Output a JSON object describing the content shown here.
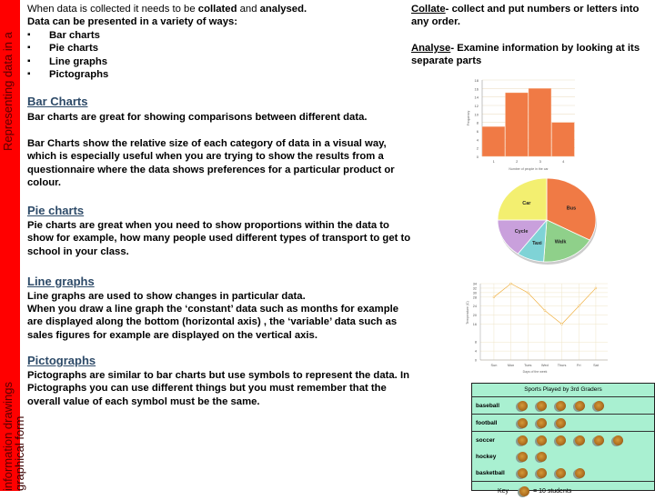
{
  "sidebar": {
    "top_text": "Representing data in a",
    "bottom_text_1": "information drawings",
    "bottom_text_2": "graphical form",
    "color": "#ff0000"
  },
  "intro": {
    "line1_prefix": "When data is collected it needs to be ",
    "line1_bold1": "collated",
    "line1_mid": " and ",
    "line1_bold2": "analysed.",
    "line2": "Data can be presented in a variety of ways:",
    "items": [
      "Bar charts",
      "Pie charts",
      "Line graphs",
      "Pictographs"
    ]
  },
  "definitions": {
    "collate_term": "Collate",
    "collate_def": "- collect and put numbers or letters into any order.",
    "analyse_term": "Analyse",
    "analyse_def": "- Examine information by looking at its separate parts"
  },
  "sections": {
    "bar": {
      "heading": "Bar Charts",
      "p1": "Bar charts are great for showing comparisons between different data.",
      "p2": "Bar Charts show the relative size of each category of data in a visual way, which is especially useful when you are trying to show the results from a questionnaire where the data shows preferences for a particular product or colour."
    },
    "pie": {
      "heading": "Pie charts",
      "p1": "Pie charts are great when you need to show proportions within the data to show for example, how many people used different types of transport to get to school in your class."
    },
    "line": {
      "heading": "Line graphs",
      "p1": "Line graphs are used to show changes in particular data.",
      "p2": "When you draw a line graph the ‘constant’ data such as months for example are displayed along the bottom (horizontal axis) , the ‘variable’ data such as sales figures for example are displayed on the vertical axis."
    },
    "picto": {
      "heading": "Pictographs",
      "p1": "Pictographs are similar to bar charts but use symbols to represent the data. In Pictographs you can use different things but you must remember that the overall value of each symbol must be the same."
    }
  },
  "chart_data": [
    {
      "type": "bar",
      "title": "",
      "xlabel": "Number of people in the car",
      "ylabel": "Frequency",
      "categories": [
        "1",
        "2",
        "3",
        "4"
      ],
      "values": [
        7,
        15,
        16,
        8
      ],
      "ylim": [
        0,
        18
      ],
      "grid": true,
      "color": "#f07a45"
    },
    {
      "type": "pie",
      "title": "",
      "labels": [
        "Bus",
        "Walk",
        "Taxi",
        "Cycle",
        "Car"
      ],
      "values": [
        33,
        18,
        9,
        15,
        25
      ],
      "colors": [
        "#f07a45",
        "#8fd08a",
        "#7fd3d6",
        "#c9a0dc",
        "#f3ef70"
      ]
    },
    {
      "type": "line",
      "title": "",
      "xlabel": "Days of the week",
      "ylabel": "Temperature (C)",
      "categories": [
        "Sun",
        "Mon",
        "Tues",
        "Wed",
        "Thurs",
        "Fri",
        "Sat"
      ],
      "values": [
        28,
        34,
        30,
        22,
        16,
        24,
        32
      ],
      "ylim": [
        0,
        34
      ],
      "grid": true,
      "color": "#f0b040"
    },
    {
      "type": "table",
      "title": "Sports Played by 3rd Graders",
      "rows": [
        {
          "label": "baseball",
          "symbols": 5
        },
        {
          "label": "football",
          "symbols": 3
        },
        {
          "label": "soccer",
          "symbols": 6
        },
        {
          "label": "hockey",
          "symbols": 2
        },
        {
          "label": "basketball",
          "symbols": 4
        }
      ],
      "key_label": "Key",
      "key_value": "= 10  students",
      "background": "#a9f0d1"
    }
  ]
}
